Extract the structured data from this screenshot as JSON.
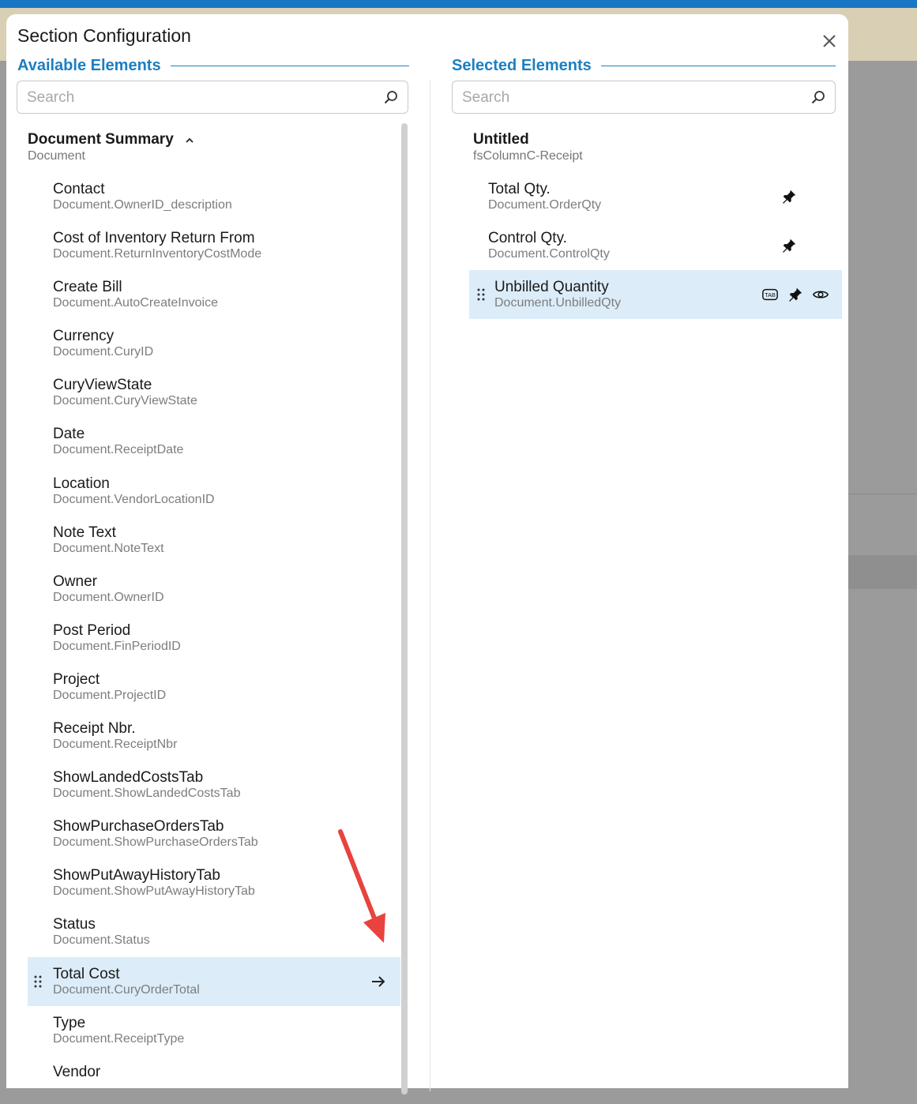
{
  "dialog": {
    "title": "Section Configuration"
  },
  "available": {
    "heading": "Available Elements",
    "search_placeholder": "Search",
    "group": {
      "title": "Document Summary",
      "subtitle": "Document"
    },
    "items": [
      {
        "name": "Contact",
        "path": "Document.OwnerID_description"
      },
      {
        "name": "Cost of Inventory Return From",
        "path": "Document.ReturnInventoryCostMode"
      },
      {
        "name": "Create Bill",
        "path": "Document.AutoCreateInvoice"
      },
      {
        "name": "Currency",
        "path": "Document.CuryID"
      },
      {
        "name": "CuryViewState",
        "path": "Document.CuryViewState"
      },
      {
        "name": "Date",
        "path": "Document.ReceiptDate"
      },
      {
        "name": "Location",
        "path": "Document.VendorLocationID"
      },
      {
        "name": "Note Text",
        "path": "Document.NoteText"
      },
      {
        "name": "Owner",
        "path": "Document.OwnerID"
      },
      {
        "name": "Post Period",
        "path": "Document.FinPeriodID"
      },
      {
        "name": "Project",
        "path": "Document.ProjectID"
      },
      {
        "name": "Receipt Nbr.",
        "path": "Document.ReceiptNbr"
      },
      {
        "name": "ShowLandedCostsTab",
        "path": "Document.ShowLandedCostsTab"
      },
      {
        "name": "ShowPurchaseOrdersTab",
        "path": "Document.ShowPurchaseOrdersTab"
      },
      {
        "name": "ShowPutAwayHistoryTab",
        "path": "Document.ShowPutAwayHistoryTab"
      },
      {
        "name": "Status",
        "path": "Document.Status"
      },
      {
        "name": "Total Cost",
        "path": "Document.CuryOrderTotal",
        "active": true
      },
      {
        "name": "Type",
        "path": "Document.ReceiptType"
      },
      {
        "name": "Vendor",
        "path": ""
      }
    ]
  },
  "selected": {
    "heading": "Selected Elements",
    "search_placeholder": "Search",
    "group": {
      "title": "Untitled",
      "subtitle": "fsColumnC-Receipt"
    },
    "items": [
      {
        "name": "Total Qty.",
        "path": "Document.OrderQty",
        "icons": [
          "pin-icon"
        ]
      },
      {
        "name": "Control Qty.",
        "path": "Document.ControlQty",
        "icons": [
          "pin-icon"
        ]
      },
      {
        "name": "Unbilled Quantity",
        "path": "Document.UnbilledQty",
        "active": true,
        "icons": [
          "tab-icon",
          "pin-icon",
          "eye-icon"
        ]
      }
    ]
  },
  "colors": {
    "accent": "#1c7fc1",
    "highlight": "#dcedf9",
    "annotation": "#e8433f"
  },
  "icons": {
    "tab_label": "TAB"
  }
}
